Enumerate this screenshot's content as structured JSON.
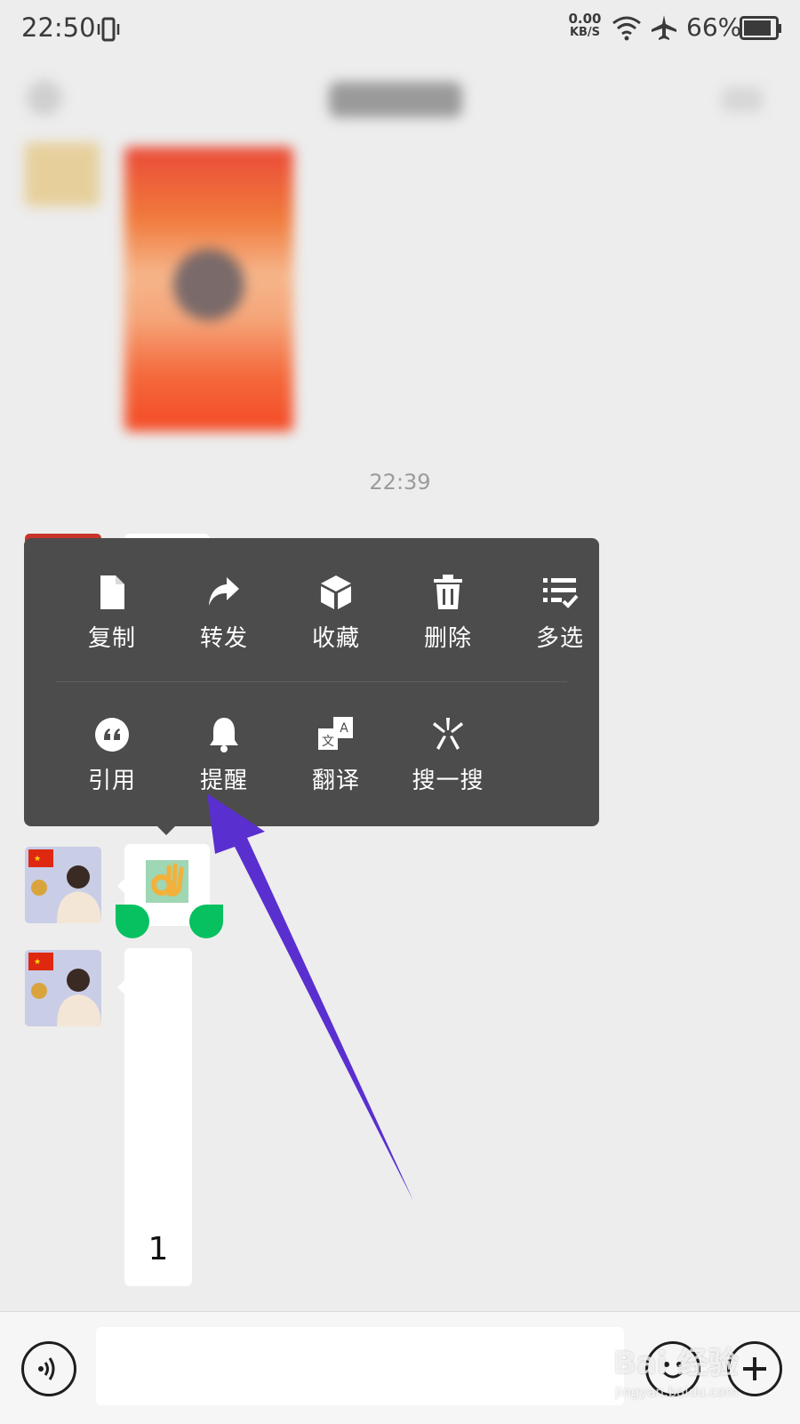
{
  "status_bar": {
    "time": "22:50",
    "net_speed_value": "0.00",
    "net_speed_unit": "KB/S",
    "battery": "66%"
  },
  "chat": {
    "timestamp": "22:39",
    "long_message_text": "1"
  },
  "context_menu": {
    "row1": [
      {
        "label": "复制",
        "icon": "copy-icon"
      },
      {
        "label": "转发",
        "icon": "forward-icon"
      },
      {
        "label": "收藏",
        "icon": "favorite-icon"
      },
      {
        "label": "删除",
        "icon": "delete-icon"
      },
      {
        "label": "多选",
        "icon": "multiselect-icon"
      }
    ],
    "row2": [
      {
        "label": "引用",
        "icon": "quote-icon"
      },
      {
        "label": "提醒",
        "icon": "remind-bell-icon"
      },
      {
        "label": "翻译",
        "icon": "translate-icon"
      },
      {
        "label": "搜一搜",
        "icon": "search-one-icon"
      }
    ]
  },
  "watermark": {
    "brand": "Bai 经验",
    "url": "jingyan.baidu.com"
  },
  "colors": {
    "menu_bg": "#4c4c4c",
    "arrow": "#5a2fd0",
    "selection_handle": "#07c160"
  }
}
